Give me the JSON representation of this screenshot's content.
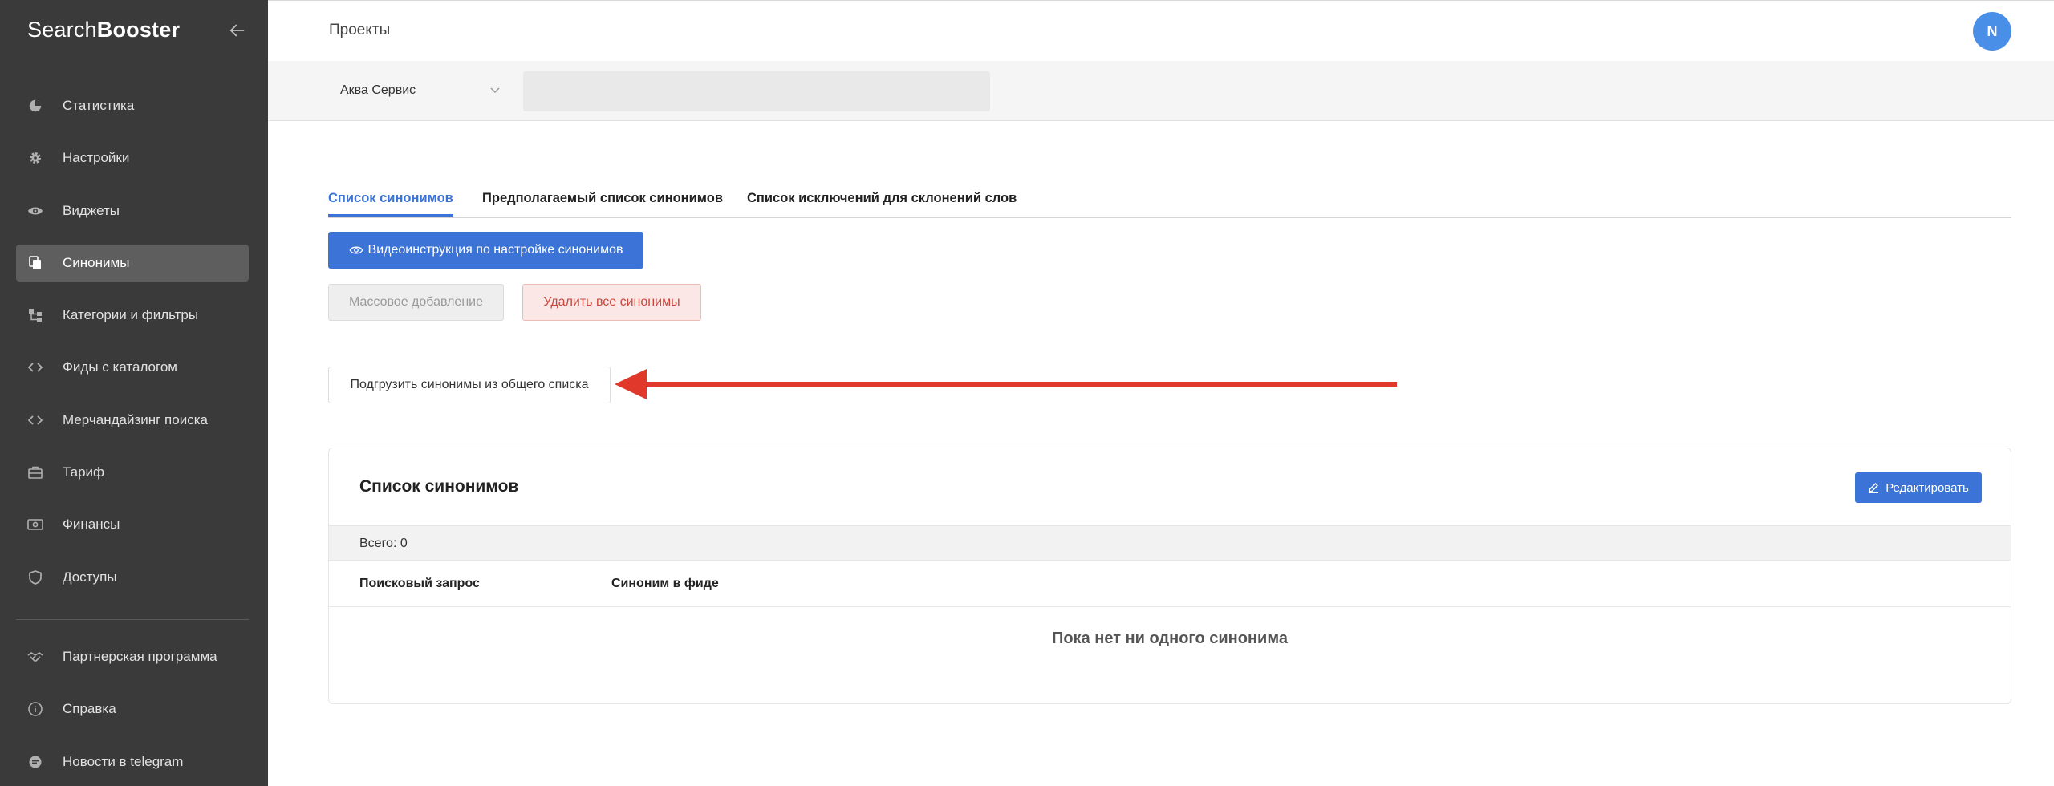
{
  "brand": {
    "part1": "Search",
    "part2": "Booster"
  },
  "sidebar": {
    "items": [
      {
        "label": "Статистика",
        "icon": "chart-pie-icon"
      },
      {
        "label": "Настройки",
        "icon": "gear-icon"
      },
      {
        "label": "Виджеты",
        "icon": "eye-icon"
      },
      {
        "label": "Синонимы",
        "icon": "copy-icon",
        "active": true
      },
      {
        "label": "Категории и фильтры",
        "icon": "hierarchy-icon"
      },
      {
        "label": "Фиды с каталогом",
        "icon": "code-icon"
      },
      {
        "label": "Мерчандайзинг поиска",
        "icon": "code-icon"
      },
      {
        "label": "Тариф",
        "icon": "briefcase-icon"
      },
      {
        "label": "Финансы",
        "icon": "money-icon"
      },
      {
        "label": "Доступы",
        "icon": "shield-icon"
      }
    ],
    "secondary": [
      {
        "label": "Партнерская программа",
        "icon": "handshake-icon"
      },
      {
        "label": "Справка",
        "icon": "info-icon"
      },
      {
        "label": "Новости в telegram",
        "icon": "chat-icon"
      }
    ]
  },
  "header": {
    "title": "Проекты",
    "avatar_initial": "N"
  },
  "project": {
    "selected": "Аква Сервис"
  },
  "tabs": [
    {
      "label": "Список синонимов",
      "active": true
    },
    {
      "label": "Предполагаемый список синонимов"
    },
    {
      "label": "Список исключений для склонений слов"
    }
  ],
  "actions": {
    "video_instruction": "Видеоинструкция по настройке синонимов",
    "bulk_add": "Массовое добавление",
    "delete_all": "Удалить все синонимы",
    "load_common": "Подгрузить синонимы из общего списка"
  },
  "card": {
    "title": "Список синонимов",
    "edit_label": "Редактировать",
    "total": "Всего: 0",
    "columns": [
      "Поисковый запрос",
      "Синоним в фиде"
    ],
    "empty_text": "Пока нет ни одного синонима"
  },
  "colors": {
    "accent": "#3b74d6",
    "sidebar": "#3a3a3a",
    "danger": "#c9473d",
    "annotation_arrow": "#e0392b"
  }
}
